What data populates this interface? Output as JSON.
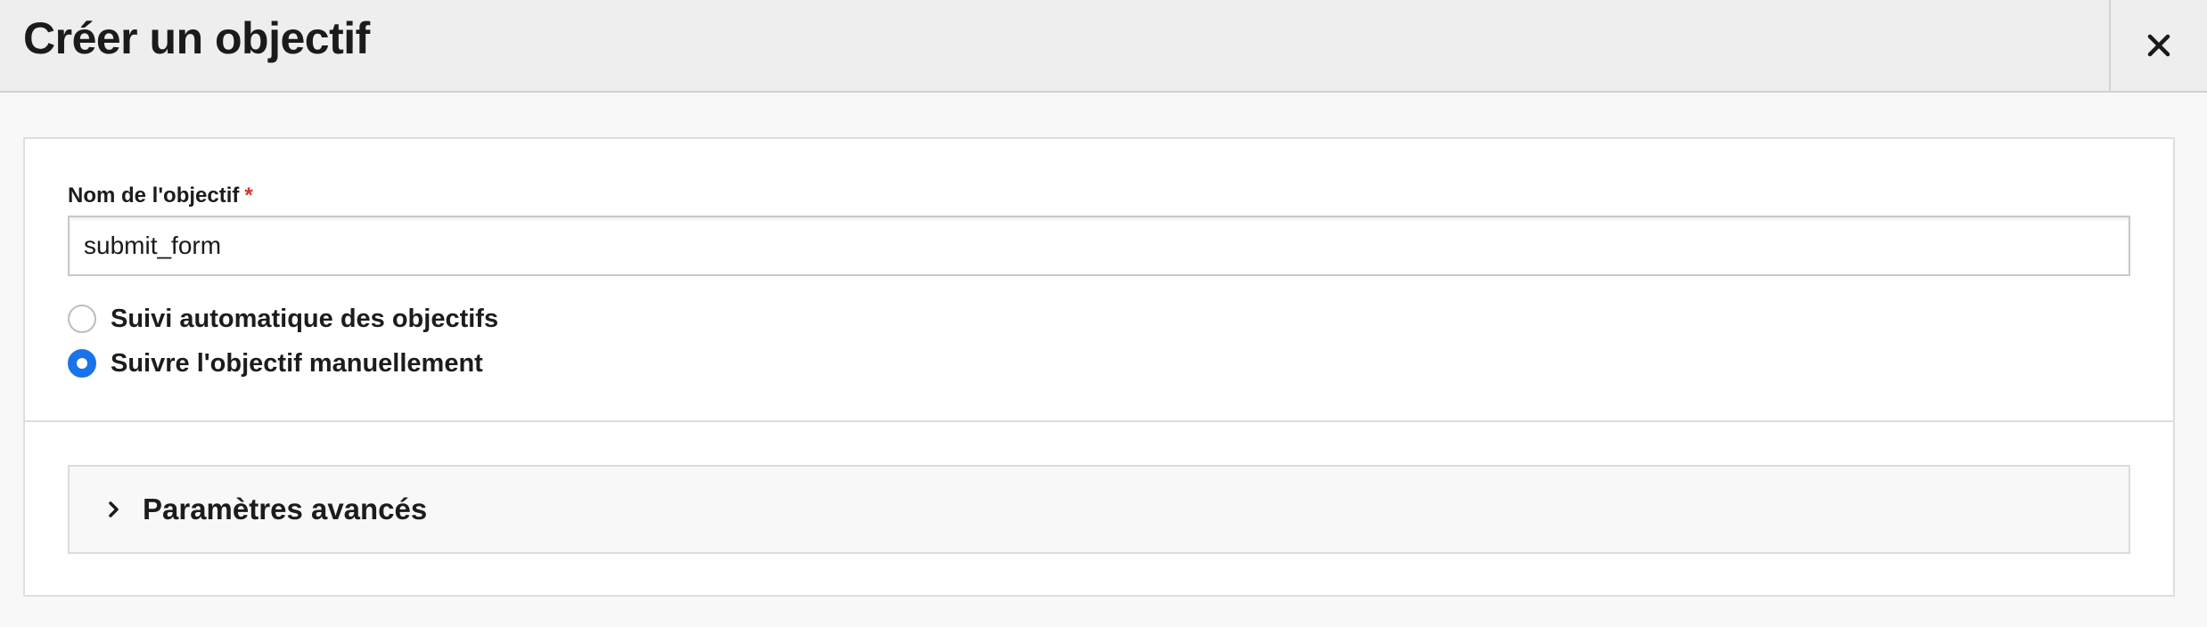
{
  "dialog": {
    "title": "Créer un objectif",
    "close_icon": "close-icon"
  },
  "form": {
    "goal_name_label": "Nom de l'objectif",
    "required_marker": "*",
    "goal_name_value": "submit_form",
    "tracking_options": [
      {
        "label": "Suivi automatique des objectifs",
        "selected": false
      },
      {
        "label": "Suivre l'objectif manuellement",
        "selected": true
      }
    ]
  },
  "advanced": {
    "label": "Paramètres avancés",
    "expanded": false,
    "icon": "chevron-right-icon"
  },
  "colors": {
    "accent": "#1a73e8",
    "required": "#d93025",
    "header_bg": "#eeeeee"
  }
}
